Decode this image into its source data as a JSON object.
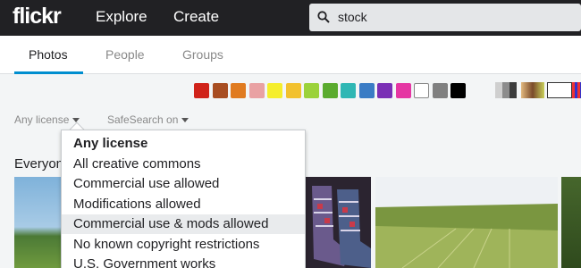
{
  "header": {
    "logo": "flickr",
    "nav": [
      "Explore",
      "Create"
    ],
    "search_value": "stock"
  },
  "tabs": [
    "Photos",
    "People",
    "Groups"
  ],
  "active_tab": "Photos",
  "color_swatches": [
    "#d0231a",
    "#a84d21",
    "#e07b20",
    "#e9a1a3",
    "#f5ee2d",
    "#f2c12e",
    "#9bd23a",
    "#5aab2e",
    "#2fb7b4",
    "#3a7cc5",
    "#7a2fb5",
    "#e536a3",
    "#ffffff",
    "#808080",
    "#000000"
  ],
  "filters": {
    "license_label": "Any license",
    "safesearch_label": "SafeSearch on"
  },
  "section_title": "Everyone",
  "license_dropdown": {
    "selected": "Any license",
    "highlighted": "Commercial use & mods allowed",
    "options": [
      "Any license",
      "All creative commons",
      "Commercial use allowed",
      "Modifications allowed",
      "Commercial use & mods allowed",
      "No known copyright restrictions",
      "U.S. Government works"
    ]
  }
}
